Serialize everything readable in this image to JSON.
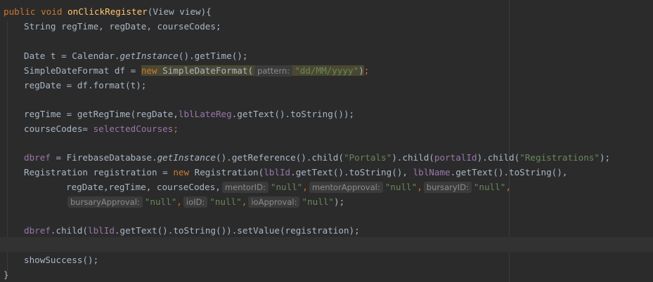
{
  "code": {
    "l1": {
      "kw_public": "public",
      "kw_void": "void",
      "method": "onClickRegister",
      "rest": "(View view){"
    },
    "l2": {
      "text": "String regTime, regDate, courseCodes;"
    },
    "l3": {
      "p1": "Date t = Calendar.",
      "italic": "getInstance",
      "p2": "().getTime();"
    },
    "l4": {
      "p1": "SimpleDateFormat df = ",
      "kw_new": "new",
      "p2": " SimpleDateFormat(",
      "hint": "pattern:",
      "str": "\"dd/MM/yyyy\"",
      "p3": ")",
      "p4": ";"
    },
    "l5": {
      "text": "regDate = df.format(t);"
    },
    "l6": {
      "p1": "regTime = getRegTime(regDate,",
      "field": "lblLateReg",
      "p2": ".getText().toString());"
    },
    "l7": {
      "p1": "courseCodes= ",
      "field": "selectedCourses",
      "p2": ";"
    },
    "l8": {
      "field": "dbref",
      "p1": " = FirebaseDatabase.",
      "italic": "getInstance",
      "p2": "().getReference().child(",
      "str1": "\"Portals\"",
      "p3": ").child(",
      "field2": "portalId",
      "p4": ").child(",
      "str2": "\"Registrations\"",
      "p5": ");"
    },
    "l9": {
      "p1": "Registration registration = ",
      "kw_new": "new",
      "p2": " Registration(",
      "field1": "lblId",
      "p3": ".getText().toString(), ",
      "field2": "lblName",
      "p4": ".getText().toString(),"
    },
    "l10": {
      "p1": "regDate,regTime, courseCodes,",
      "hint1": "mentorID:",
      "str1": "\"null\"",
      "c1": ",",
      "hint2": "mentorApproval:",
      "str2": "\"null\"",
      "c2": ",",
      "hint3": "bursaryID:",
      "str3": "\"null\"",
      "c3": ","
    },
    "l11": {
      "hint1": "bursaryApproval:",
      "str1": "\"null\"",
      "c1": ",",
      "hint2": "ioID:",
      "str2": "\"null\"",
      "c2": ",",
      "hint3": "ioApproval:",
      "str3": "\"null\"",
      "end": ");"
    },
    "l12": {
      "field1": "dbref",
      "p1": ".child(",
      "field2": "lblId",
      "p2": ".getText().toString()).setValue(registration);"
    },
    "l13": {
      "text": "showSuccess();"
    },
    "l14": {
      "text": "}"
    }
  },
  "colors": {
    "background": "#2b2b2b",
    "keyword": "#cc7832",
    "method": "#ffc66d",
    "string": "#6a8759",
    "field": "#9876aa",
    "default": "#a9b7c6"
  }
}
